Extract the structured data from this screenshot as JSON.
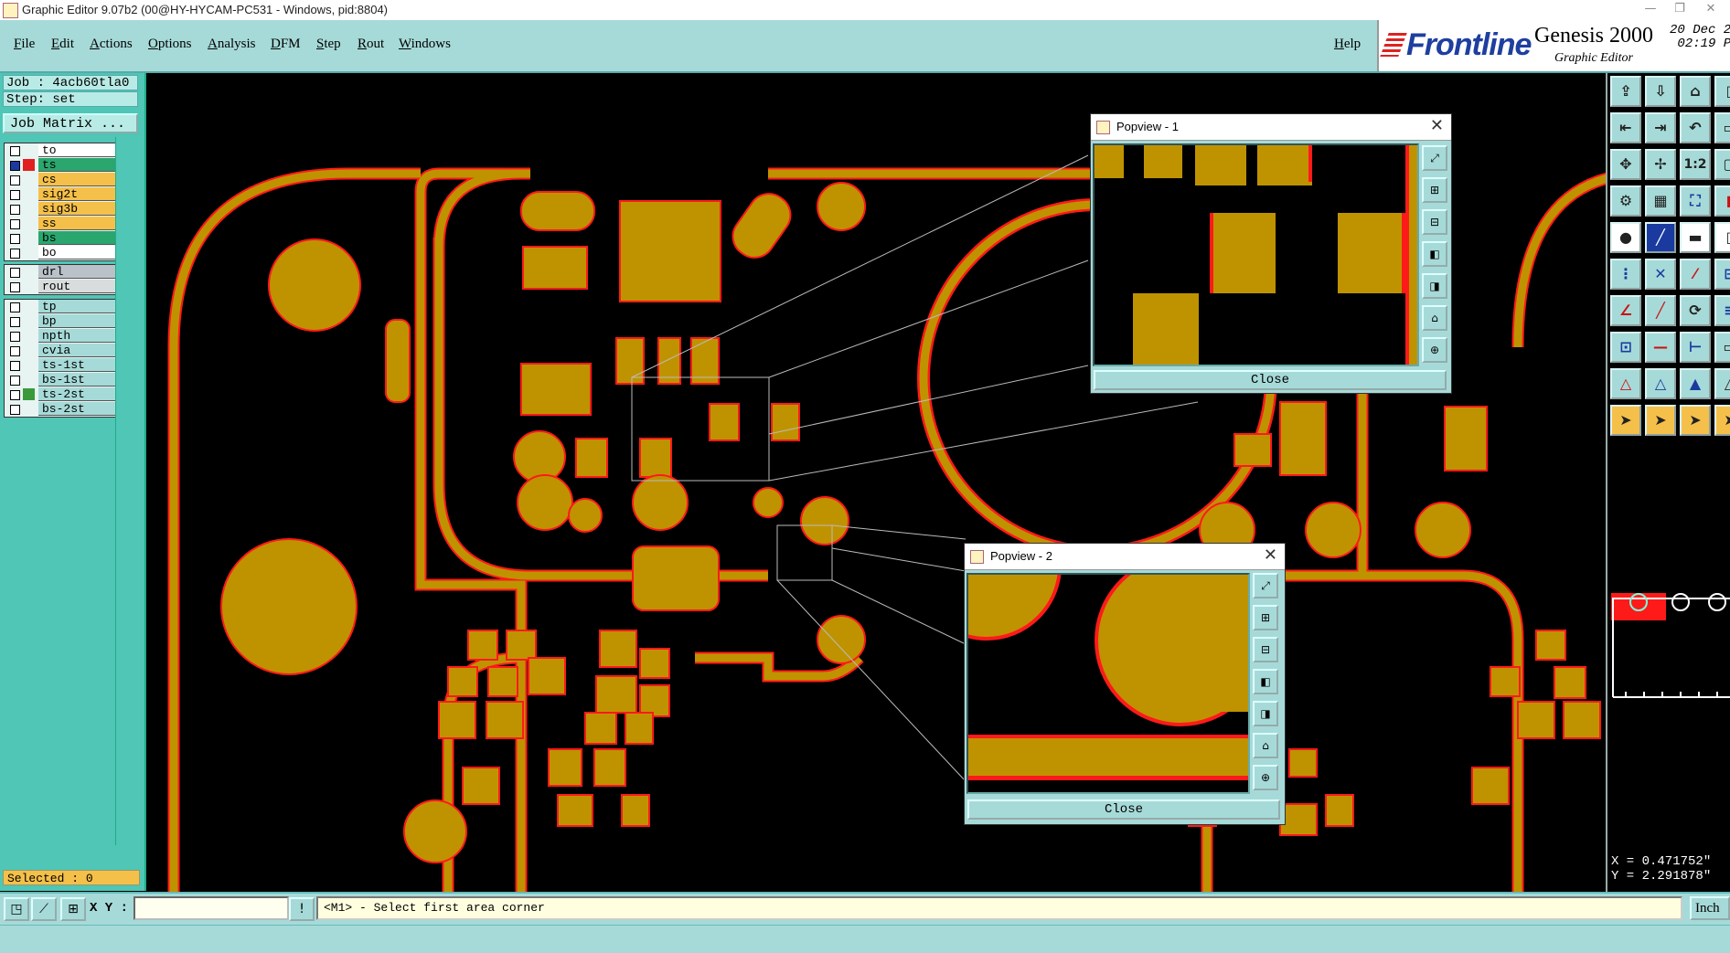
{
  "window": {
    "title": "Graphic Editor 9.07b2 (00@HY-HYCAM-PC531 - Windows, pid:8804)",
    "controls": [
      "—",
      "❐",
      "✕"
    ]
  },
  "menubar": {
    "items": [
      "File",
      "Edit",
      "Actions",
      "Options",
      "Analysis",
      "DFM",
      "Step",
      "Rout",
      "Windows"
    ],
    "help": "Help"
  },
  "logo": {
    "brand": "Frontline",
    "product": "Genesis 2000",
    "subtitle": "Graphic Editor",
    "date_line1": "20 Dec 2",
    "date_line2": " 02:19 P"
  },
  "leftpanel": {
    "job": "Job : 4acb60tla0",
    "step": "Step: set",
    "job_matrix": "Job Matrix ...",
    "board_layers": [
      {
        "name": "to",
        "color": "#ffffff",
        "swatch": "",
        "checked": false
      },
      {
        "name": "ts",
        "color": "#2aa66e",
        "swatch": "#e02020",
        "checked": true
      },
      {
        "name": "cs",
        "color": "#f5c04a",
        "swatch": "",
        "checked": false
      },
      {
        "name": "sig2t",
        "color": "#f5c04a",
        "swatch": "",
        "checked": false
      },
      {
        "name": "sig3b",
        "color": "#f5c04a",
        "swatch": "",
        "checked": false
      },
      {
        "name": "ss",
        "color": "#f5c04a",
        "swatch": "",
        "checked": false
      },
      {
        "name": "bs",
        "color": "#2aa66e",
        "swatch": "",
        "checked": false
      },
      {
        "name": "bo",
        "color": "#ffffff",
        "swatch": "",
        "checked": false
      }
    ],
    "drill_layers": [
      {
        "name": "drl",
        "color": "#b9c2c8",
        "swatch": "",
        "checked": false
      },
      {
        "name": "rout",
        "color": "#d8dcdc",
        "swatch": "",
        "checked": false
      }
    ],
    "misc_layers": [
      {
        "name": "tp",
        "color": "#a6dad8",
        "swatch": "",
        "checked": false
      },
      {
        "name": "bp",
        "color": "#a6dad8",
        "swatch": "",
        "checked": false
      },
      {
        "name": "npth",
        "color": "#a6dad8",
        "swatch": "",
        "checked": false
      },
      {
        "name": "cvia",
        "color": "#a6dad8",
        "swatch": "",
        "checked": false
      },
      {
        "name": "ts-1st",
        "color": "#a6dad8",
        "swatch": "",
        "checked": false
      },
      {
        "name": "bs-1st",
        "color": "#a6dad8",
        "swatch": "",
        "checked": false
      },
      {
        "name": "ts-2st",
        "color": "#a6dad8",
        "swatch": "#3a9a3a",
        "checked": false
      },
      {
        "name": "bs-2st",
        "color": "#a6dad8",
        "swatch": "",
        "checked": false
      }
    ],
    "selected": "Selected : 0"
  },
  "popview1": {
    "title": "Popview - 1",
    "close": "Close"
  },
  "popview2": {
    "title": "Popview - 2",
    "close": "Close"
  },
  "rightpanel": {
    "coord_x": "X = 0.471752\"",
    "coord_y": "Y = 2.291878\"",
    "tool_ratio": "1:2"
  },
  "statusbar": {
    "xy_label": "X Y :",
    "xy_value": "",
    "prompt": "<M1> - Select first area corner",
    "unit": "Inch"
  },
  "colors": {
    "copper": "#bf9300",
    "outline": "#ff1a1a",
    "panel": "#a6dad8",
    "layer_panel": "#4fc6b6"
  }
}
